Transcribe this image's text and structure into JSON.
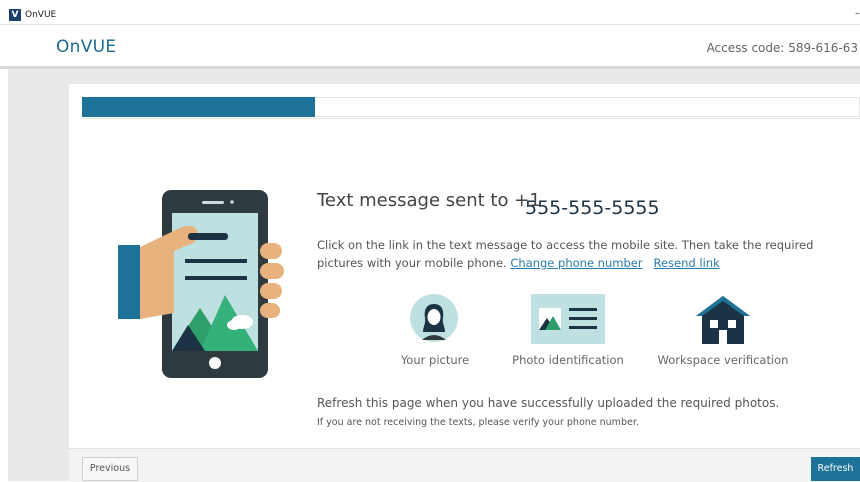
{
  "window": {
    "title": "OnVUE",
    "logo_letter": "V",
    "minimize": "–"
  },
  "header": {
    "brand": "OnVUE",
    "access_code": "Access code: 589-616-63"
  },
  "progress": {
    "fraction": 0.3
  },
  "content": {
    "title": "Text message sent to +1",
    "phone_number": "555-555-5555",
    "instructions": "Click on the link in the text message to access the mobile site. Then take the required pictures with your mobile phone.",
    "change_phone_link": "Change phone number",
    "resend_link": "Resend link",
    "steps": [
      {
        "label": "Your picture",
        "icon": "person-icon"
      },
      {
        "label": "Photo identification",
        "icon": "id-card-icon"
      },
      {
        "label": "Workspace verification",
        "icon": "house-icon"
      }
    ],
    "refresh_note": "Refresh this page when you have successfully uploaded the required photos.",
    "verify_note": "If you are not receiving the texts, please verify your phone number."
  },
  "footer": {
    "previous_label": "Previous",
    "refresh_label": "Refresh"
  },
  "colors": {
    "accent": "#1c7297",
    "dark": "#2f3a3f",
    "screen": "#bfe0e0",
    "green": "#2e9e6a",
    "hand": "#e8b27e"
  }
}
